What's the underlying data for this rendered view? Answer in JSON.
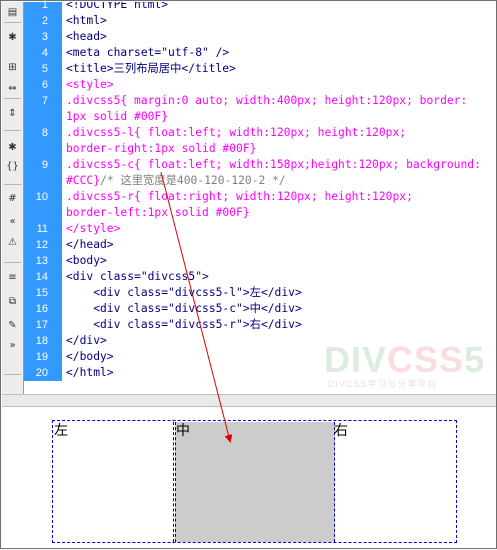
{
  "toolbar": {
    "icons": [
      "document-icon",
      "expand-icon",
      "collapse-icon",
      "select-parent-icon",
      "balance-icon",
      "format-icon",
      "comment-icon",
      "css-icon",
      "indent-icon",
      "warning-icon",
      "move-icon",
      "snippet-icon",
      "outdent-icon",
      "more-icon"
    ]
  },
  "editor": {
    "lines": [
      {
        "num": "1",
        "parts": [
          {
            "t": "<!DOCTYPE html>",
            "c": "tag"
          }
        ]
      },
      {
        "num": "2",
        "parts": [
          {
            "t": "<html>",
            "c": "tag"
          }
        ]
      },
      {
        "num": "3",
        "parts": [
          {
            "t": "<head>",
            "c": "tag"
          }
        ]
      },
      {
        "num": "4",
        "parts": [
          {
            "t": "<meta charset=\"utf-8\" />",
            "c": "tag"
          }
        ]
      },
      {
        "num": "5",
        "parts": [
          {
            "t": "<title>",
            "c": "tag"
          },
          {
            "t": "三列布局居中",
            "c": "text"
          },
          {
            "t": "</title>",
            "c": "tag"
          }
        ]
      },
      {
        "num": "6",
        "parts": [
          {
            "t": "<style>",
            "c": "css"
          }
        ]
      },
      {
        "num": "7",
        "parts": [
          {
            "t": ".divcss5{ margin:0 auto; width:400px; height:120px; border:",
            "c": "css"
          }
        ]
      },
      {
        "num": "",
        "parts": [
          {
            "t": "1px solid #00F}",
            "c": "css"
          }
        ]
      },
      {
        "num": "8",
        "parts": [
          {
            "t": ".divcss5-l{ float:left; width:120px; height:120px;",
            "c": "css"
          }
        ]
      },
      {
        "num": "",
        "parts": [
          {
            "t": "border-right:1px solid #00F}",
            "c": "css"
          }
        ]
      },
      {
        "num": "9",
        "parts": [
          {
            "t": ".divcss5-c{ float:left; width:158px;height:120px; background:",
            "c": "css"
          }
        ]
      },
      {
        "num": "",
        "parts": [
          {
            "t": "#CCC}",
            "c": "css"
          },
          {
            "t": "/* 这里宽度是400-120-120-2 */",
            "c": "cmt"
          }
        ]
      },
      {
        "num": "10",
        "parts": [
          {
            "t": ".divcss5-r{ float:right; width:120px; height:120px;",
            "c": "css"
          }
        ]
      },
      {
        "num": "",
        "parts": [
          {
            "t": "border-left:1px solid #00F}",
            "c": "css"
          }
        ]
      },
      {
        "num": "11",
        "parts": [
          {
            "t": "</style>",
            "c": "css"
          }
        ]
      },
      {
        "num": "12",
        "parts": [
          {
            "t": "</head>",
            "c": "tag"
          }
        ]
      },
      {
        "num": "13",
        "parts": [
          {
            "t": "<body>",
            "c": "tag"
          }
        ]
      },
      {
        "num": "14",
        "parts": [
          {
            "t": "<div class=\"divcss5\">",
            "c": "tag"
          }
        ]
      },
      {
        "num": "15",
        "parts": [
          {
            "t": "    <div class=\"divcss5-l\">",
            "c": "tag"
          },
          {
            "t": "左",
            "c": "text"
          },
          {
            "t": "</div>",
            "c": "tag"
          }
        ]
      },
      {
        "num": "16",
        "parts": [
          {
            "t": "    <div class=\"divcss5-c\">",
            "c": "tag"
          },
          {
            "t": "中",
            "c": "text"
          },
          {
            "t": "</div>",
            "c": "tag"
          }
        ]
      },
      {
        "num": "17",
        "parts": [
          {
            "t": "    <div class=\"divcss5-r\">",
            "c": "tag"
          },
          {
            "t": "右",
            "c": "text"
          },
          {
            "t": "</div>",
            "c": "tag"
          }
        ]
      },
      {
        "num": "18",
        "parts": [
          {
            "t": "</div>",
            "c": "tag"
          }
        ]
      },
      {
        "num": "19",
        "parts": [
          {
            "t": "</body>",
            "c": "tag"
          }
        ]
      },
      {
        "num": "20",
        "parts": [
          {
            "t": "</html>",
            "c": "tag"
          }
        ]
      }
    ]
  },
  "watermark": {
    "logo_a": "DIV",
    "logo_b": "CSS",
    "logo_c": "5",
    "subtitle": "DIVCSS学习与分享平台"
  },
  "preview": {
    "left": "左",
    "center": "中",
    "right": "右"
  },
  "colors": {
    "gutter": "#3399ff",
    "tag": "#000080",
    "css": "#ff00ff",
    "comment": "#808080",
    "center_bg": "#cccccc",
    "border": "#0000cc",
    "arrow": "#e00000"
  }
}
